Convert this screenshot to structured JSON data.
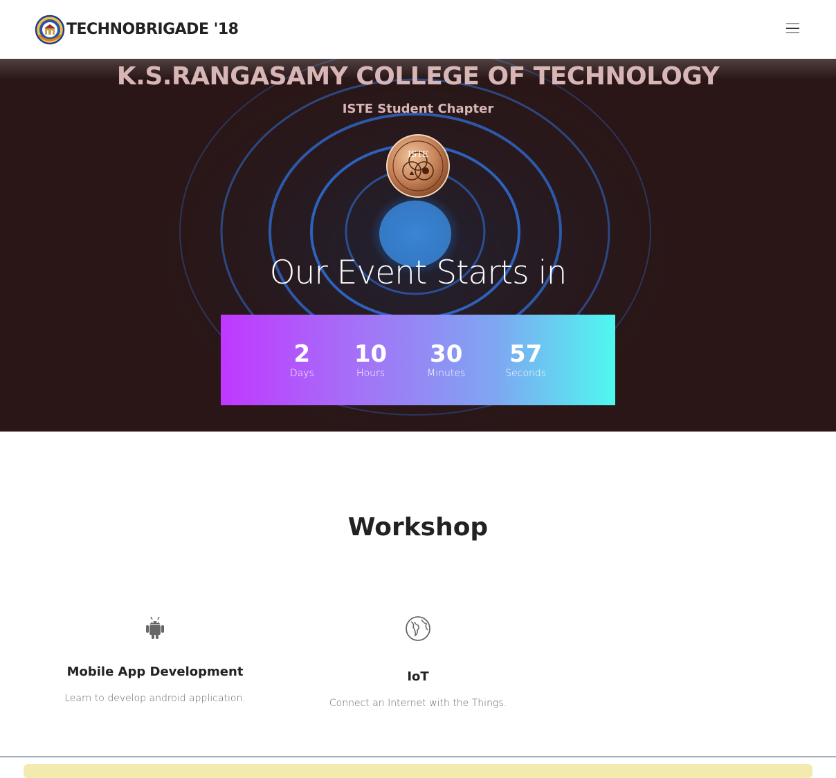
{
  "navbar": {
    "brand_text": "TECHNOBRIGADE '18",
    "logo_icon": "college-crest-icon",
    "menu_icon": "hamburger-menu-icon"
  },
  "hero": {
    "college_name": "K.S.RANGASAMY COLLEGE OF TECHNOLOGY",
    "chapter_name": "ISTE Student Chapter",
    "iste_logo_text": "ISTE",
    "event_heading": "Our Event Starts in",
    "countdown": [
      {
        "value": "2",
        "label": "Days"
      },
      {
        "value": "10",
        "label": "Hours"
      },
      {
        "value": "30",
        "label": "Minutes"
      },
      {
        "value": "57",
        "label": "Seconds"
      }
    ],
    "colors": {
      "gradient_start": "#c038ff",
      "gradient_end": "#4ff8ef",
      "background": "#2a1616",
      "ring": "#2f6fd8"
    }
  },
  "workshop": {
    "title": "Workshop",
    "items": [
      {
        "icon": "android-icon",
        "title": "Mobile App Development",
        "description": "Learn to develop android application."
      },
      {
        "icon": "globe-icon",
        "title": "IoT",
        "description": "Connect an Internet with the Things."
      }
    ]
  }
}
